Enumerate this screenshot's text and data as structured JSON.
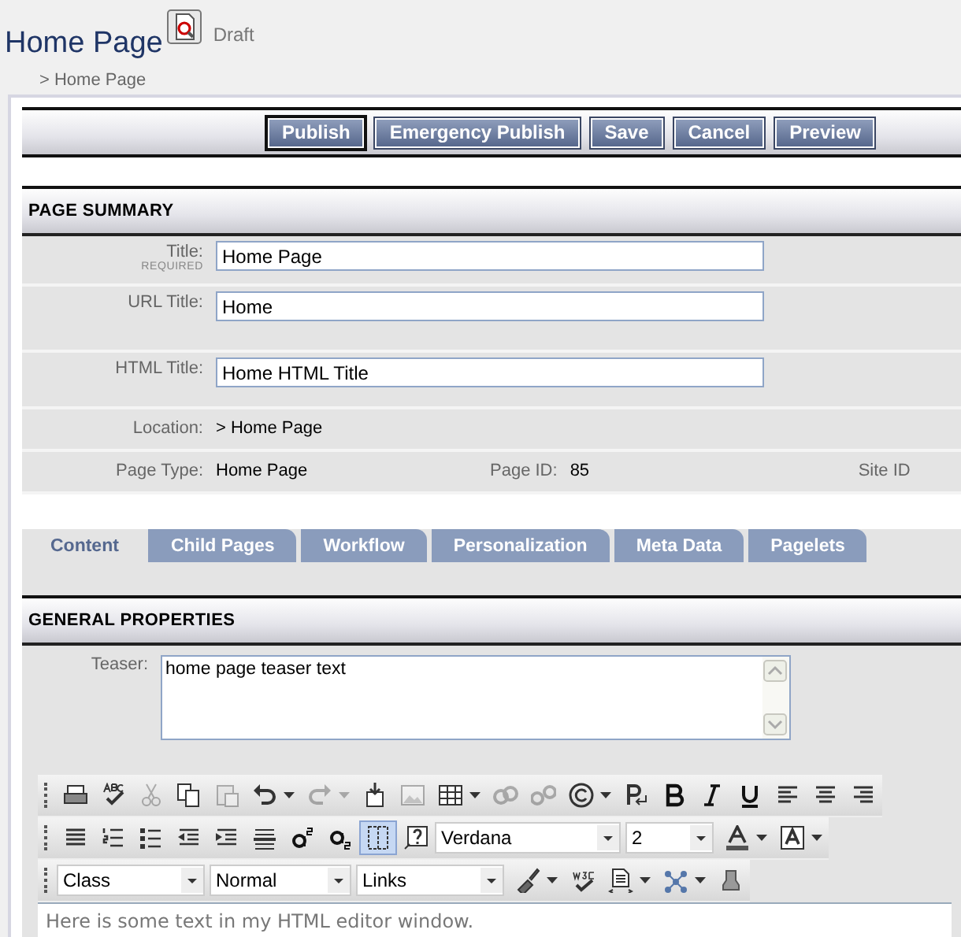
{
  "header": {
    "title": "Home Page",
    "status": "Draft",
    "breadcrumb": "> Home Page"
  },
  "actions": [
    {
      "label": "Publish",
      "selected": true
    },
    {
      "label": "Emergency Publish",
      "selected": false
    },
    {
      "label": "Save",
      "selected": false
    },
    {
      "label": "Cancel",
      "selected": false
    },
    {
      "label": "Preview",
      "selected": false
    }
  ],
  "page_summary": {
    "heading": "PAGE SUMMARY",
    "fields": [
      {
        "kind": "input",
        "label": "Title:",
        "note": "REQUIRED",
        "value": "Home Page"
      },
      {
        "kind": "input",
        "label": "URL Title:",
        "value": "Home"
      },
      {
        "kind": "input",
        "label": "HTML Title:",
        "value": "Home HTML Title"
      },
      {
        "kind": "text",
        "label": "Location:",
        "value": "> Home Page"
      },
      {
        "kind": "info",
        "label": "Page Type:",
        "value": "Home Page",
        "label_2": "Page ID:",
        "value_2": "85",
        "label_3": "Site ID"
      }
    ]
  },
  "tabs": [
    {
      "label": "Content",
      "selected": true
    },
    {
      "label": "Child Pages",
      "selected": false
    },
    {
      "label": "Workflow",
      "selected": false
    },
    {
      "label": "Personalization",
      "selected": false
    },
    {
      "label": "Meta Data",
      "selected": false
    },
    {
      "label": "Pagelets",
      "selected": false
    }
  ],
  "general_properties": {
    "heading": "GENERAL PROPERTIES",
    "teaser_label": "Teaser:",
    "teaser_value": "home page teaser text"
  },
  "editor": {
    "toolbars": [
      [
        {
          "kind": "button",
          "disabled": false
        },
        {
          "kind": "button",
          "disabled": false
        },
        {
          "kind": "button",
          "disabled": true
        },
        {
          "kind": "button",
          "disabled": false
        },
        {
          "kind": "button",
          "disabled": true
        },
        {
          "kind": "split",
          "disabled": false
        },
        {
          "kind": "split",
          "disabled": true
        },
        {
          "kind": "button",
          "disabled": false
        },
        {
          "kind": "button",
          "disabled": true
        },
        {
          "kind": "split",
          "disabled": false
        },
        {
          "kind": "button",
          "disabled": true
        },
        {
          "kind": "button",
          "disabled": true
        },
        {
          "kind": "split",
          "disabled": false
        },
        {
          "kind": "button",
          "disabled": false
        },
        {
          "kind": "button",
          "disabled": false
        },
        {
          "kind": "button",
          "disabled": false
        },
        {
          "kind": "button",
          "disabled": false
        },
        {
          "kind": "button",
          "disabled": false
        },
        {
          "kind": "button",
          "disabled": false
        },
        {
          "kind": "button",
          "disabled": false
        }
      ],
      [
        {
          "kind": "button",
          "disabled": false
        },
        {
          "kind": "button",
          "disabled": false
        },
        {
          "kind": "button",
          "disabled": false
        },
        {
          "kind": "button",
          "disabled": false
        },
        {
          "kind": "button",
          "disabled": false
        },
        {
          "kind": "button",
          "disabled": false
        },
        {
          "kind": "button",
          "disabled": false
        },
        {
          "kind": "button",
          "disabled": false
        },
        {
          "kind": "button",
          "disabled": false,
          "on": true
        },
        {
          "kind": "button",
          "disabled": false
        },
        {
          "kind": "select",
          "value": "Verdana"
        },
        {
          "kind": "select",
          "value": "2"
        },
        {
          "kind": "split",
          "disabled": false
        },
        {
          "kind": "split",
          "disabled": false
        }
      ],
      [
        {
          "kind": "select",
          "value": "Class"
        },
        {
          "kind": "select",
          "value": "Normal"
        },
        {
          "kind": "select",
          "value": "Links"
        },
        {
          "kind": "split",
          "disabled": false
        },
        {
          "kind": "button",
          "disabled": false
        },
        {
          "kind": "split",
          "disabled": false
        },
        {
          "kind": "split",
          "disabled": false
        },
        {
          "kind": "button",
          "disabled": false
        }
      ]
    ],
    "content": "Here is some text in my HTML editor window."
  }
}
